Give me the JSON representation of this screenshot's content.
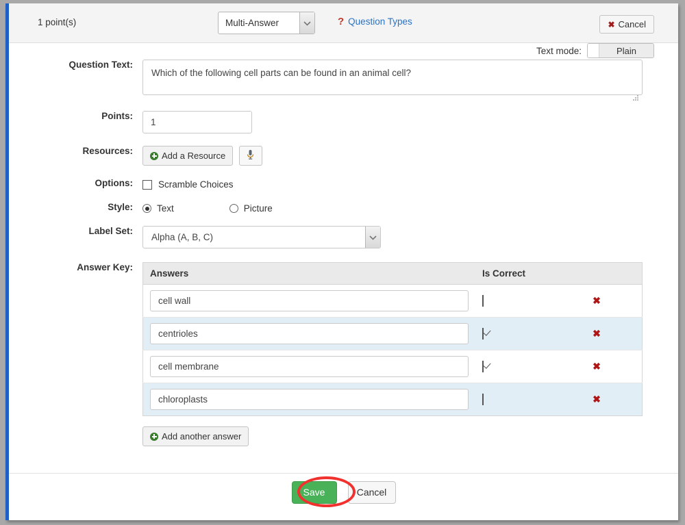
{
  "header": {
    "points_label": "1 point(s)",
    "question_type": "Multi-Answer",
    "question_types_link": "Question Types",
    "question_types_icon": "question-mark-icon",
    "cancel_label": "Cancel",
    "cancel_icon": "x-icon",
    "dropdown_icon": "chevron-down-icon"
  },
  "form": {
    "question_text": {
      "label": "Question Text:",
      "value": "Which of the following cell parts can be found in an animal cell?",
      "textmode_label": "Text mode:",
      "textmode_value": "Plain"
    },
    "points": {
      "label": "Points:",
      "value": "1"
    },
    "resources": {
      "label": "Resources:",
      "add_resource_label": "Add a Resource",
      "add_resource_icon": "plus-circle-icon",
      "mic_icon": "microphone-icon"
    },
    "options": {
      "label": "Options:",
      "scramble_label": "Scramble Choices",
      "scramble_checked": false
    },
    "style": {
      "label": "Style:",
      "choices": [
        {
          "label": "Text",
          "selected": true
        },
        {
          "label": "Picture",
          "selected": false
        }
      ]
    },
    "label_set": {
      "label": "Label Set:",
      "value": "Alpha (A, B, C)",
      "dropdown_icon": "chevron-down-icon"
    },
    "answer_key": {
      "label": "Answer Key:",
      "columns": [
        "Answers",
        "Is Correct",
        ""
      ],
      "rows": [
        {
          "answer": "cell wall",
          "is_correct": false,
          "delete_icon": "x-icon"
        },
        {
          "answer": "centrioles",
          "is_correct": true,
          "delete_icon": "x-icon"
        },
        {
          "answer": "cell membrane",
          "is_correct": true,
          "delete_icon": "x-icon"
        },
        {
          "answer": "chloroplasts",
          "is_correct": false,
          "delete_icon": "x-icon"
        }
      ],
      "add_answer_label": "Add another answer",
      "add_answer_icon": "plus-circle-icon"
    }
  },
  "footer": {
    "save_label": "Save",
    "cancel_label": "Cancel"
  },
  "colors": {
    "accent_blue": "#1f5fc4",
    "link_blue": "#2a72c4",
    "save_green": "#49b158",
    "danger_red": "#b01515",
    "highlight_red": "#f0312e",
    "row_alt": "#e2eef5"
  }
}
